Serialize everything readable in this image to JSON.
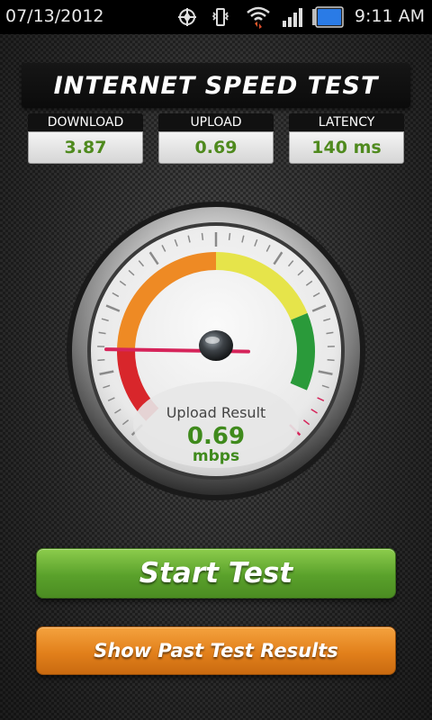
{
  "status_bar": {
    "date": "07/13/2012",
    "time": "9:11 AM",
    "icons": [
      "gps-icon",
      "vibrate-icon",
      "wifi-icon",
      "signal-icon",
      "battery-icon"
    ]
  },
  "header": {
    "title": "INTERNET SPEED TEST"
  },
  "stats": {
    "download": {
      "label": "DOWNLOAD",
      "value": "3.87"
    },
    "upload": {
      "label": "UPLOAD",
      "value": "0.69"
    },
    "latency": {
      "label": "LATENCY",
      "value": "140 ms"
    }
  },
  "gauge": {
    "caption": "Upload Result",
    "value": "0.69",
    "unit": "mbps",
    "needle_fraction": 0.17,
    "colors": {
      "red": "#d8262b",
      "orange": "#ee8a24",
      "yellow": "#e6e44a",
      "green": "#2a9a3a",
      "needle": "#d6245a"
    }
  },
  "buttons": {
    "start_label": "Start Test",
    "past_label": "Show Past Test Results"
  },
  "colors": {
    "value_green": "#4f8a1e",
    "start_button": "#5aa12b",
    "past_button": "#e2801b"
  }
}
